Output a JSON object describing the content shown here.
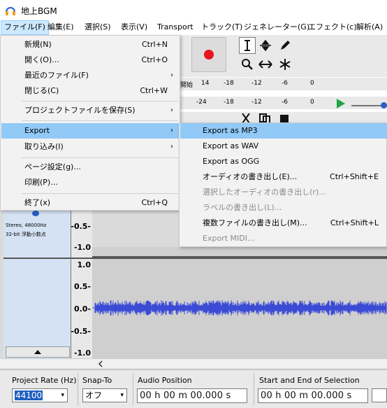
{
  "window": {
    "title": "地上BGM"
  },
  "menubar": {
    "items": [
      {
        "label": "ファイル(F)"
      },
      {
        "label": "編集(E)"
      },
      {
        "label": "選択(S)"
      },
      {
        "label": "表示(V)"
      },
      {
        "label": "Transport"
      },
      {
        "label": "トラック(T)"
      },
      {
        "label": "ジェネレーター(G)"
      },
      {
        "label": "エフェクト(c)"
      },
      {
        "label": "解析(A)"
      }
    ]
  },
  "file_menu": {
    "items": [
      {
        "label": "新規(N)",
        "shortcut": "Ctrl+N"
      },
      {
        "label": "開く(O)...",
        "shortcut": "Ctrl+O"
      },
      {
        "label": "最近のファイル(F)",
        "submenu": "›"
      },
      {
        "label": "閉じる(C)",
        "shortcut": "Ctrl+W"
      },
      {
        "label": "プロジェクトファイルを保存(S)",
        "submenu": "›"
      },
      {
        "label": "Export",
        "submenu": "›"
      },
      {
        "label": "取り込み(I)",
        "submenu": "›"
      },
      {
        "label": "ページ設定(g)..."
      },
      {
        "label": "印刷(P)..."
      },
      {
        "label": "終了(x)",
        "shortcut": "Ctrl+Q"
      }
    ]
  },
  "export_menu": {
    "items": [
      {
        "label": "Export as MP3"
      },
      {
        "label": "Export as WAV"
      },
      {
        "label": "Export as OGG"
      },
      {
        "label": "オーディオの書き出し(E)...",
        "shortcut": "Ctrl+Shift+E"
      },
      {
        "label": "選択したオーディオの書き出し(r)..."
      },
      {
        "label": "ラベルの書き出し(L)..."
      },
      {
        "label": "複数ファイルの書き出し(M)...",
        "shortcut": "Ctrl+Shift+L"
      },
      {
        "label": "Export MIDI..."
      }
    ]
  },
  "meters": {
    "record_label": "開始",
    "record_ticks": [
      "14",
      "-18",
      "-12",
      "-6",
      "0"
    ],
    "play_ticks": [
      "-24",
      "-18",
      "-12",
      "-6",
      "0"
    ]
  },
  "track": {
    "info_line1": "Stereo, 48000Hz",
    "info_line2": "32-bit 浮動小数点",
    "scale_top": [
      "-0.5-",
      "-1.0"
    ],
    "scale_bottom": [
      "1.0",
      "0.5-",
      "0.0-",
      "-0.5-",
      "-1.0"
    ]
  },
  "selection_toolbar": {
    "project_rate_label": "Project Rate (Hz)",
    "project_rate_value": "44100",
    "snap_to_label": "Snap-To",
    "snap_to_value": "オフ",
    "audio_position_label": "Audio Position",
    "audio_position_value": "00 h 00 m 00.000 s",
    "selection_label": "Start and End of Selection",
    "selection_start_value": "00 h 00 m 00.000 s"
  },
  "colors": {
    "menu_highlight": "#91c9f7",
    "waveform": "#3b4bd6",
    "record": "#e8141e"
  }
}
